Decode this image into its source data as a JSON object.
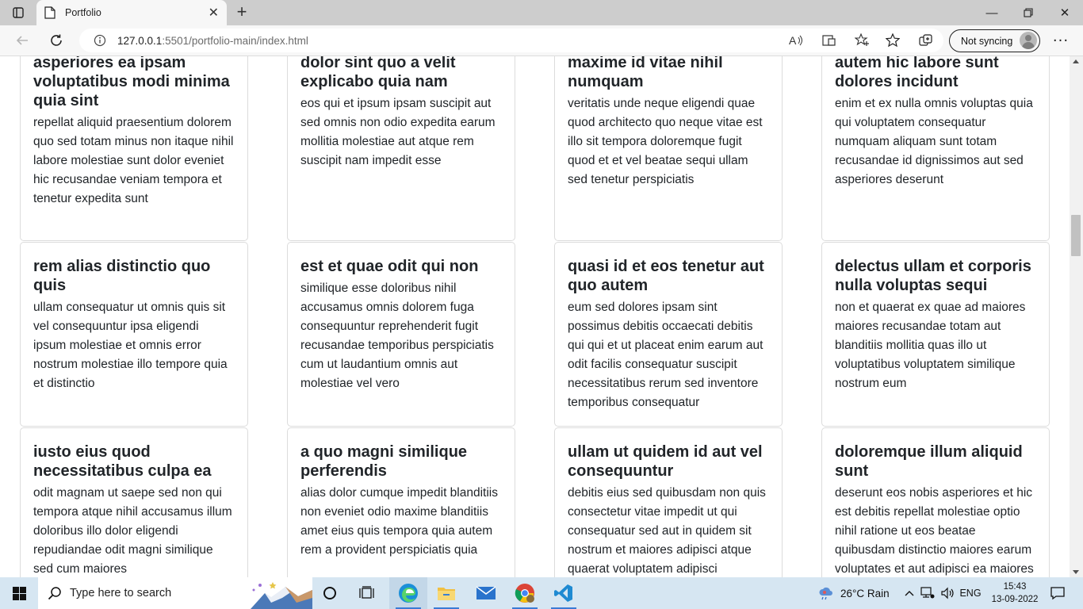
{
  "browser": {
    "tab_title": "Portfolio",
    "url_host": "127.0.0.1",
    "url_rest": ":5501/portfolio-main/index.html",
    "sync_label": "Not syncing"
  },
  "cards": [
    {
      "title": "asperiores ea ipsam voluptatibus modi minima quia sint",
      "body": "repellat aliquid praesentium dolorem quo sed totam minus non itaque nihil labore molestiae sunt dolor eveniet hic recusandae veniam tempora et tenetur expedita sunt"
    },
    {
      "title": "dolor sint quo a velit explicabo quia nam",
      "body": "eos qui et ipsum ipsam suscipit aut sed omnis non odio expedita earum mollitia molestiae aut atque rem suscipit nam impedit esse"
    },
    {
      "title": "maxime id vitae nihil numquam",
      "body": "veritatis unde neque eligendi quae quod architecto quo neque vitae est illo sit tempora doloremque fugit quod et et vel beatae sequi ullam sed tenetur perspiciatis"
    },
    {
      "title": "autem hic labore sunt dolores incidunt",
      "body": "enim et ex nulla omnis voluptas quia qui voluptatem consequatur numquam aliquam sunt totam recusandae id dignissimos aut sed asperiores deserunt"
    },
    {
      "title": "rem alias distinctio quo quis",
      "body": "ullam consequatur ut omnis quis sit vel consequuntur ipsa eligendi ipsum molestiae et omnis error nostrum molestiae illo tempore quia et distinctio"
    },
    {
      "title": "est et quae odit qui non",
      "body": "similique esse doloribus nihil accusamus omnis dolorem fuga consequuntur reprehenderit fugit recusandae temporibus perspiciatis cum ut laudantium omnis aut molestiae vel vero"
    },
    {
      "title": "quasi id et eos tenetur aut quo autem",
      "body": "eum sed dolores ipsam sint possimus debitis occaecati debitis qui qui et ut placeat enim earum aut odit facilis consequatur suscipit necessitatibus rerum sed inventore temporibus consequatur"
    },
    {
      "title": "delectus ullam et corporis nulla voluptas sequi",
      "body": "non et quaerat ex quae ad maiores maiores recusandae totam aut blanditiis mollitia quas illo ut voluptatibus voluptatem similique nostrum eum"
    },
    {
      "title": "iusto eius quod necessitatibus culpa ea",
      "body": "odit magnam ut saepe sed non qui tempora atque nihil accusamus illum doloribus illo dolor eligendi repudiandae odit magni similique sed cum maiores"
    },
    {
      "title": "a quo magni similique perferendis",
      "body": "alias dolor cumque impedit blanditiis non eveniet odio maxime blanditiis amet eius quis tempora quia autem rem a provident perspiciatis quia"
    },
    {
      "title": "ullam ut quidem id aut vel consequuntur",
      "body": "debitis eius sed quibusdam non quis consectetur vitae impedit ut qui consequatur sed aut in quidem sit nostrum et maiores adipisci atque quaerat voluptatem adipisci repudiandae"
    },
    {
      "title": "doloremque illum aliquid sunt",
      "body": "deserunt eos nobis asperiores et hic est debitis repellat molestiae optio nihil ratione ut eos beatae quibusdam distinctio maiores earum voluptates et aut adipisci ea maiores voluptas maxime"
    }
  ],
  "taskbar": {
    "search_placeholder": "Type here to search",
    "weather": "26°C  Rain",
    "language": "ENG",
    "time": "15:43",
    "date": "13-09-2022"
  }
}
